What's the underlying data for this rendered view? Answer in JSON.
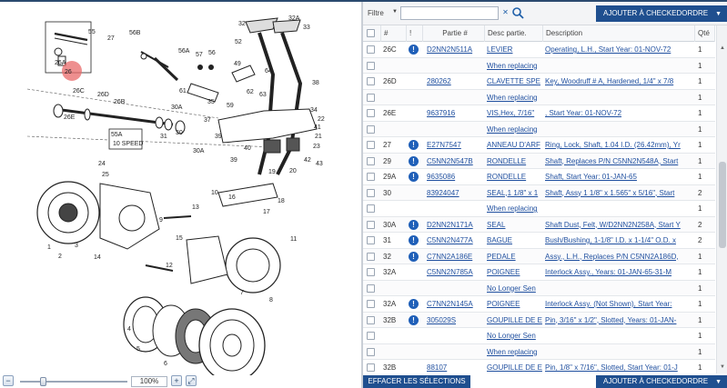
{
  "filter": {
    "label": "Filtre",
    "input_value": "",
    "input_placeholder": ""
  },
  "toolbar": {
    "add_to_checkorder_label": "AJOUTER À CHECKEDORDRE"
  },
  "bottom": {
    "clear_selection_label": "EFFACER LES SÉLECTIONS",
    "add_to_checkorder_label": "AJOUTER À CHECKEDORDRE"
  },
  "zoom": {
    "value": "100%"
  },
  "colors": {
    "accent": "#1f4f8f",
    "link": "#1f4f9f",
    "info_badge": "#1f5fb8",
    "highlight_marker": "#e86a6a"
  },
  "grid": {
    "headers": {
      "num": "#",
      "flag": "!",
      "part": "Partie #",
      "desc": "Desc partie.",
      "longdesc": "Description",
      "qty": "Qté"
    },
    "rows": [
      {
        "num": "26C",
        "info": true,
        "part": "D2NN2N511A",
        "desc": "LEVIER",
        "longdesc": "Operating, L.H., Start Year: 01-NOV-72",
        "qty": "1"
      },
      {
        "num": "",
        "info": false,
        "part": "",
        "desc": "When replacing",
        "longdesc": "",
        "qty": "1"
      },
      {
        "num": "26D",
        "info": false,
        "part": "280262",
        "desc": "CLAVETTE SPE",
        "longdesc": "Key, Woodruff # A, Hardened, 1/4\" x 7/8",
        "qty": "1"
      },
      {
        "num": "",
        "info": false,
        "part": "",
        "desc": "When replacing",
        "longdesc": "",
        "qty": "1"
      },
      {
        "num": "26E",
        "info": false,
        "part": "9637916",
        "desc": "VIS,Hex, 7/16\"",
        "longdesc": ", Start Year: 01-NOV-72",
        "qty": "1"
      },
      {
        "num": "",
        "info": false,
        "part": "",
        "desc": "When replacing",
        "longdesc": "",
        "qty": "1"
      },
      {
        "num": "27",
        "info": true,
        "part": "E27N7547",
        "desc": "ANNEAU D'ARF",
        "longdesc": "Ring, Lock, Shaft, 1.04 I.D. (26.42mm), Yr",
        "qty": "1"
      },
      {
        "num": "29",
        "info": true,
        "part": "C5NN2N547B",
        "desc": "RONDELLE",
        "longdesc": "Shaft, Replaces P/N C5NN2N548A, Start",
        "qty": "1"
      },
      {
        "num": "29A",
        "info": true,
        "part": "9635086",
        "desc": "RONDELLE",
        "longdesc": "Shaft, Start Year: 01-JAN-65",
        "qty": "1"
      },
      {
        "num": "30",
        "info": false,
        "part": "83924047",
        "desc": "SEAL,1 1/8\" x 1",
        "longdesc": "Shaft, Assy 1 1/8\" x 1.565\" x 5/16\", Start",
        "qty": "2"
      },
      {
        "num": "",
        "info": false,
        "part": "",
        "desc": "When replacing",
        "longdesc": "",
        "qty": "1"
      },
      {
        "num": "30A",
        "info": true,
        "part": "D2NN2N171A",
        "desc": "SEAL",
        "longdesc": "Shaft Dust, Felt, W/D2NN2N258A, Start Y",
        "qty": "2"
      },
      {
        "num": "31",
        "info": true,
        "part": "C5NN2N477A",
        "desc": "BAGUE",
        "longdesc": "Bush/Bushing, 1-1/8\" I.D. x 1-1/4\" O.D. x",
        "qty": "2"
      },
      {
        "num": "32",
        "info": true,
        "part": "C7NN2A186E",
        "desc": "PEDALE",
        "longdesc": "Assy., L.H., Replaces P/N C5NN2A186D,",
        "qty": "1"
      },
      {
        "num": "32A",
        "info": false,
        "part": "C5NN2N785A",
        "desc": "POIGNEE",
        "longdesc": "Interlock Assy., Years: 01-JAN-65-31-M",
        "qty": "1"
      },
      {
        "num": "",
        "info": false,
        "part": "",
        "desc": "No Longer Sen",
        "longdesc": "",
        "qty": "1"
      },
      {
        "num": "32A",
        "info": true,
        "part": "C7NN2N145A",
        "desc": "POIGNEE",
        "longdesc": "Interlock Assy. (Not Shown), Start Year:",
        "qty": "1"
      },
      {
        "num": "32B",
        "info": true,
        "part": "305029S",
        "desc": "GOUPILLE DE E",
        "longdesc": "Pin, 3/16\" x 1/2\", Slotted, Years: 01-JAN-",
        "qty": "1"
      },
      {
        "num": "",
        "info": false,
        "part": "",
        "desc": "No Longer Sen",
        "longdesc": "",
        "qty": "1"
      },
      {
        "num": "",
        "info": false,
        "part": "",
        "desc": "When replacing",
        "longdesc": "",
        "qty": "1"
      },
      {
        "num": "32B",
        "info": false,
        "part": "88107",
        "desc": "GOUPILLE DE E",
        "longdesc": "Pin, 1/8\" x 7/16\", Slotted, Start Year: 01-J",
        "qty": "1"
      }
    ]
  },
  "diagram": {
    "labels": [
      "32",
      "32A",
      "33",
      "55",
      "27",
      "56B",
      "56A",
      "57",
      "56",
      "49",
      "52",
      "64",
      "61",
      "62",
      "63",
      "26A",
      "26",
      "26C",
      "26D",
      "26B",
      "26E",
      "30A",
      "35",
      "37",
      "59",
      "39",
      "38",
      "34",
      "41",
      "22",
      "21",
      "23",
      "55A",
      "10 SPEED",
      "31",
      "30",
      "30A",
      "40",
      "42",
      "39",
      "19",
      "20",
      "43",
      "24",
      "25",
      "13",
      "14",
      "15",
      "11",
      "18",
      "17",
      "16",
      "12",
      "10",
      "7",
      "8",
      "9",
      "1",
      "2",
      "3",
      "4",
      "5",
      "6"
    ]
  }
}
